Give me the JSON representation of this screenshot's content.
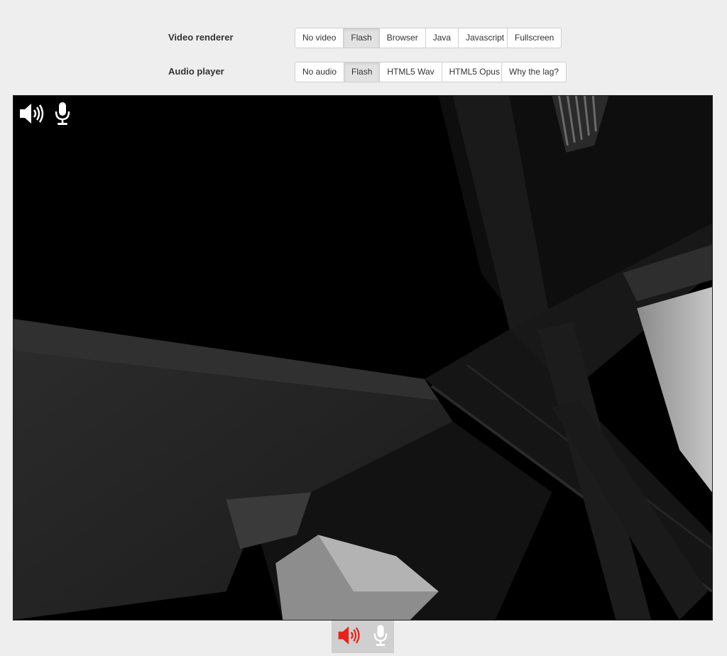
{
  "video_renderer": {
    "label": "Video renderer",
    "options": [
      "No video",
      "Flash",
      "Browser",
      "Java",
      "Javascript"
    ],
    "selected": "Flash",
    "fullscreen_label": "Fullscreen"
  },
  "audio_player": {
    "label": "Audio player",
    "options": [
      "No audio",
      "Flash",
      "HTML5 Wav",
      "HTML5 Opus"
    ],
    "selected": "Flash",
    "lag_label": "Why the lag?"
  },
  "overlay_icons": [
    "speaker-icon",
    "microphone-icon"
  ],
  "bottom_controls": {
    "speaker": {
      "icon": "speaker-icon",
      "color": "#e8211b"
    },
    "microphone": {
      "icon": "microphone-icon",
      "color": "#ffffff"
    }
  }
}
